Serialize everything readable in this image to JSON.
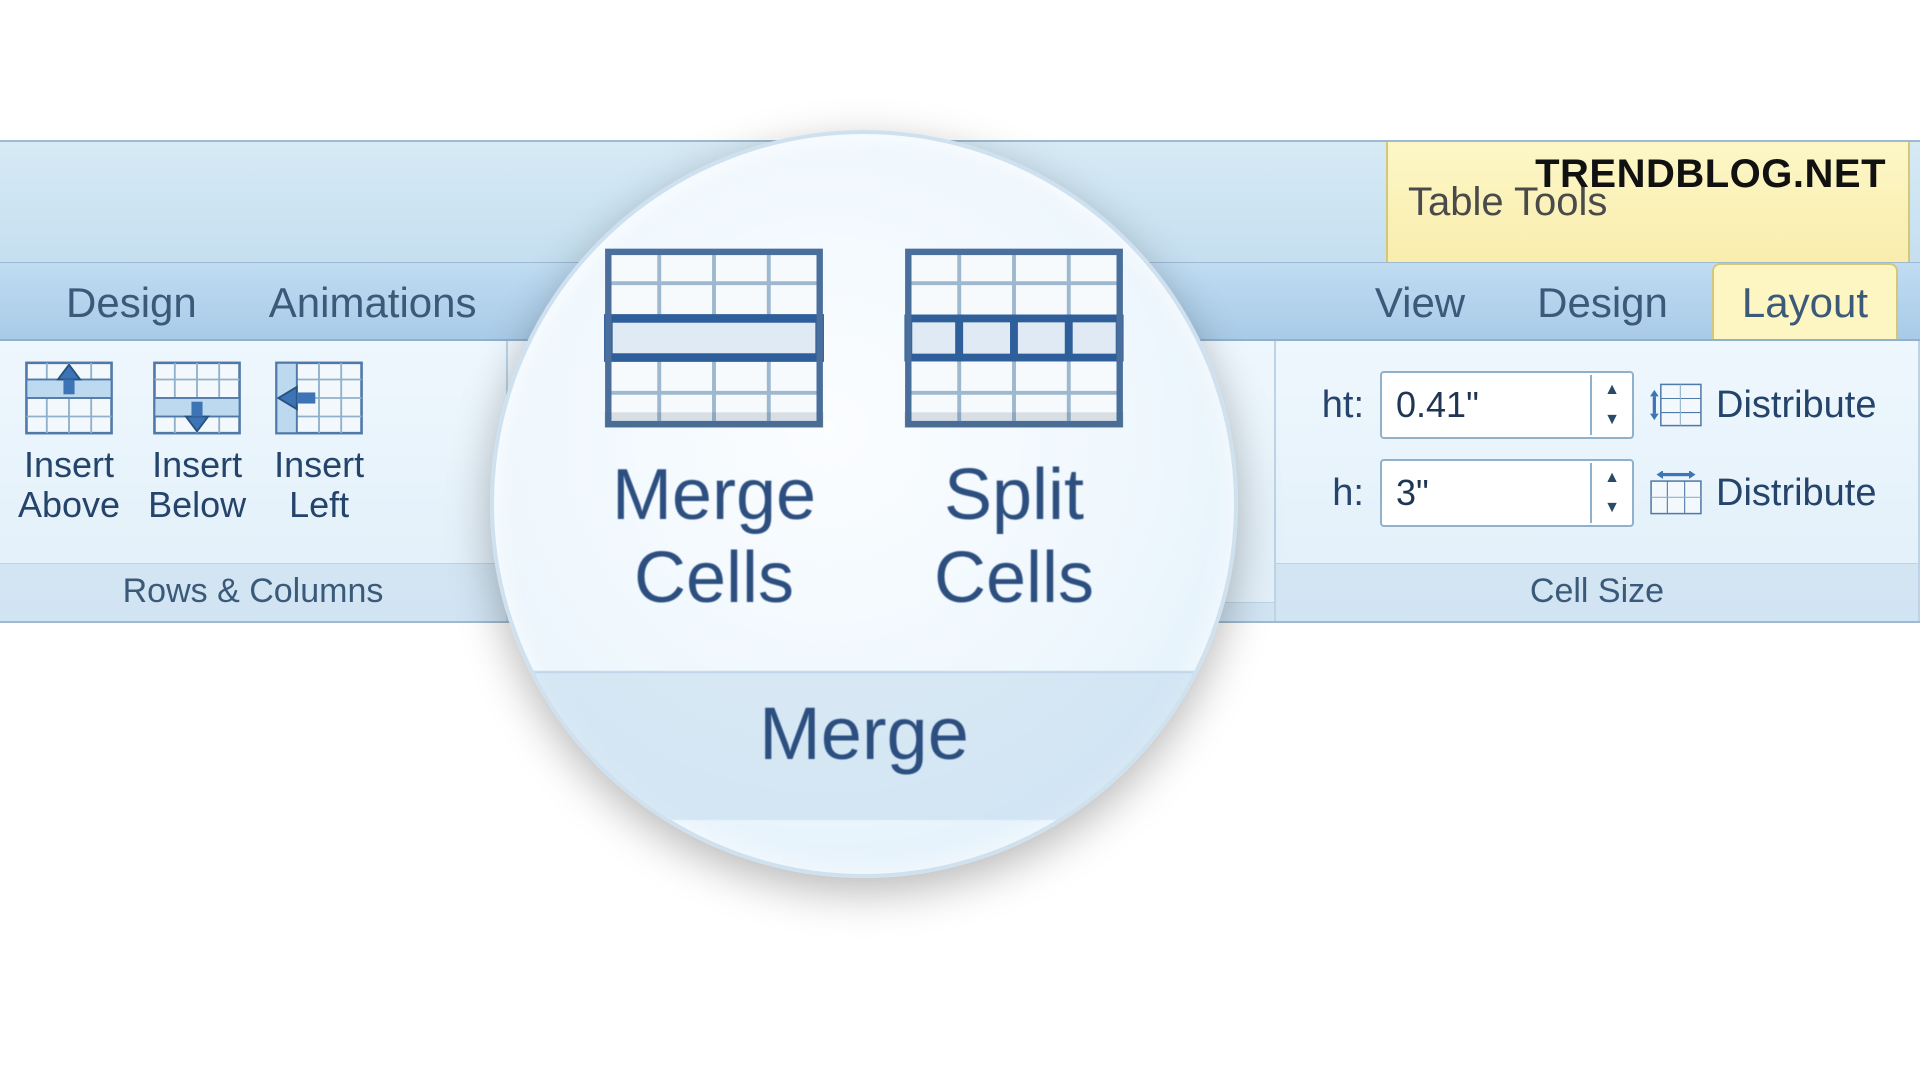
{
  "watermark": "TRENDBLOG.NET",
  "context_tab": "Table Tools",
  "tabs": {
    "design1": "Design",
    "animations": "Animations",
    "view": "View",
    "design2": "Design",
    "layout": "Layout"
  },
  "groups": {
    "rows_columns": {
      "label": "Rows & Columns",
      "insert_above": "Insert\nAbove",
      "insert_below": "Insert\nBelow",
      "insert_left": "Insert\nLeft"
    },
    "merge": {
      "label": "Merge",
      "merge_cells": "Merge\nCells",
      "split_cells": "Split\nCells"
    },
    "cell_size": {
      "label": "Cell Size",
      "height_label": "ht:",
      "height_value": "0.41\"",
      "width_label": "h:",
      "width_value": "3\"",
      "distribute_rows": "Distribute",
      "distribute_cols": "Distribute"
    }
  }
}
